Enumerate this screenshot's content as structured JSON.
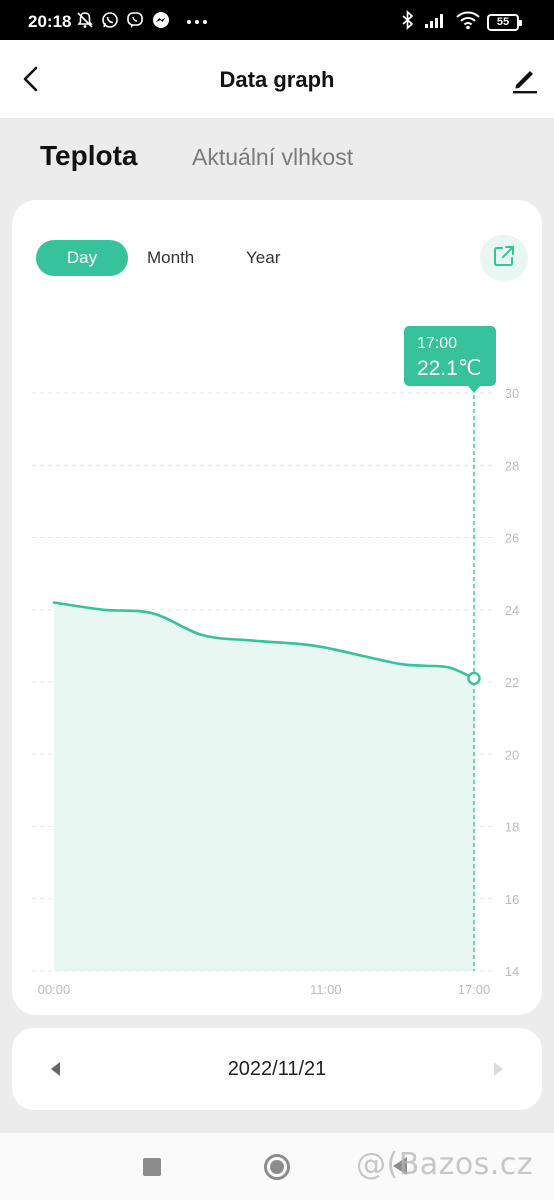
{
  "status_bar": {
    "time": "20:18",
    "battery": "55",
    "icons": [
      "bell-off-icon",
      "whatsapp-icon",
      "viber-icon",
      "messenger-icon",
      "more-dots-icon",
      "bluetooth-icon",
      "signal-icon",
      "wifi-icon",
      "battery-icon"
    ]
  },
  "header": {
    "title": "Data graph",
    "back_icon": "chevron-left-icon",
    "edit_icon": "pencil-icon"
  },
  "tabs": [
    {
      "label": "Teplota",
      "active": true
    },
    {
      "label": "Aktuální vlhkost",
      "active": false
    }
  ],
  "period": {
    "options": [
      "Day",
      "Month",
      "Year"
    ],
    "selected": "Day",
    "export_icon": "external-link-icon"
  },
  "tooltip": {
    "time": "17:00",
    "value": "22.1℃"
  },
  "chart_data": {
    "type": "area",
    "x": [
      "00:00",
      "02:00",
      "04:00",
      "06:00",
      "08:00",
      "10:00",
      "11:00",
      "12:00",
      "14:00",
      "15:00",
      "16:00",
      "17:00"
    ],
    "y": [
      24.2,
      24.0,
      23.9,
      23.3,
      23.15,
      23.05,
      22.95,
      22.8,
      22.5,
      22.45,
      22.4,
      22.1
    ],
    "xticks": [
      "00:00",
      "11:00",
      "17:00"
    ],
    "yticks": [
      14,
      16,
      18,
      20,
      22,
      24,
      26,
      28,
      30
    ],
    "ylim": [
      14,
      30
    ],
    "grid": true,
    "highlight": {
      "x": "17:00",
      "y": 22.1
    },
    "color": "#36c29b",
    "fill_color": "#e8f7f2"
  },
  "date_nav": {
    "date": "2022/11/21",
    "prev_icon": "triangle-left-icon",
    "next_icon": "triangle-right-icon"
  },
  "navbar": {
    "icons": [
      "recent-apps-icon",
      "home-icon",
      "back-icon"
    ]
  },
  "watermark": "@(Bazos.cz"
}
